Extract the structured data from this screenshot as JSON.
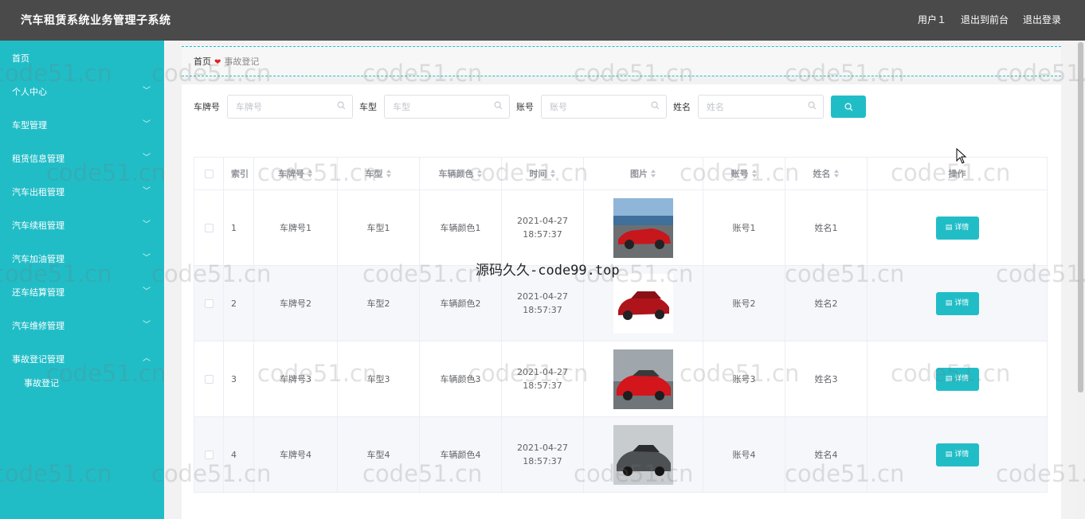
{
  "header": {
    "title": "汽车租赁系统业务管理子系统",
    "nav": [
      "用户１",
      "退出到前台",
      "退出登录"
    ]
  },
  "sidebar": {
    "items": [
      {
        "label": "首页",
        "chevron": false
      },
      {
        "label": "个人中心",
        "chevron": "down"
      },
      {
        "label": "车型管理",
        "chevron": "down"
      },
      {
        "label": "租赁信息管理",
        "chevron": "down"
      },
      {
        "label": "汽车出租管理",
        "chevron": "down"
      },
      {
        "label": "汽车续租管理",
        "chevron": "down"
      },
      {
        "label": "汽车加油管理",
        "chevron": "down"
      },
      {
        "label": "还车结算管理",
        "chevron": "down"
      },
      {
        "label": "汽车维修管理",
        "chevron": "down"
      },
      {
        "label": "事故登记管理",
        "chevron": "up"
      }
    ],
    "subitem": "事故登记"
  },
  "breadcrumb": {
    "home": "首页",
    "sep": "❤",
    "current": "事故登记"
  },
  "search": {
    "fields": [
      {
        "label": "车牌号",
        "placeholder": "车牌号"
      },
      {
        "label": "车型",
        "placeholder": "车型"
      },
      {
        "label": "账号",
        "placeholder": "账号"
      },
      {
        "label": "姓名",
        "placeholder": "姓名"
      }
    ]
  },
  "table": {
    "headers": [
      "索引",
      "车牌号",
      "车型",
      "车辆颜色",
      "时间",
      "图片",
      "账号",
      "姓名",
      "操作"
    ],
    "rows": [
      {
        "idx": "1",
        "plate": "车牌号1",
        "type": "车型1",
        "color": "车辆颜色1",
        "time": "2021-04-27 18:57:37",
        "account": "账号1",
        "name": "姓名1",
        "img": "red-convertible"
      },
      {
        "idx": "2",
        "plate": "车牌号2",
        "type": "车型2",
        "color": "车辆颜色2",
        "time": "2021-04-27 18:57:37",
        "account": "账号2",
        "name": "姓名2",
        "img": "red-sedan"
      },
      {
        "idx": "3",
        "plate": "车牌号3",
        "type": "车型3",
        "color": "车辆颜色3",
        "time": "2021-04-27 18:57:37",
        "account": "账号3",
        "name": "姓名3",
        "img": "red-sports"
      },
      {
        "idx": "4",
        "plate": "车牌号4",
        "type": "车型4",
        "color": "车辆颜色4",
        "time": "2021-04-27 18:57:37",
        "account": "账号4",
        "name": "姓名4",
        "img": "grey-muscle"
      }
    ],
    "detail_label": "详情"
  },
  "overlay_text": "源码久久-code99.top",
  "watermark": "code51.cn",
  "colors": {
    "accent": "#21bdc7",
    "topbar": "#4a4a4a"
  }
}
